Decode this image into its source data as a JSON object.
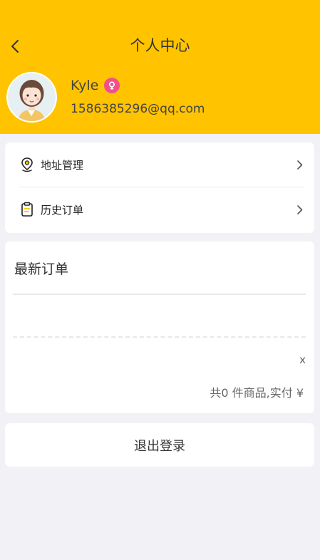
{
  "header": {
    "title": "个人中心",
    "accent_color": "#ffc300"
  },
  "profile": {
    "name": "Kyle",
    "email": "1586385296@qq.com",
    "gender_icon": "female-icon",
    "gender_color": "#f1508a"
  },
  "menu": {
    "items": [
      {
        "label": "地址管理",
        "icon": "location-pin-icon"
      },
      {
        "label": "历史订单",
        "icon": "clipboard-icon"
      }
    ]
  },
  "latest_order": {
    "title": "最新订单",
    "close_label": "x",
    "summary": "共0 件商品,实付 ¥"
  },
  "logout": {
    "label": "退出登录"
  }
}
